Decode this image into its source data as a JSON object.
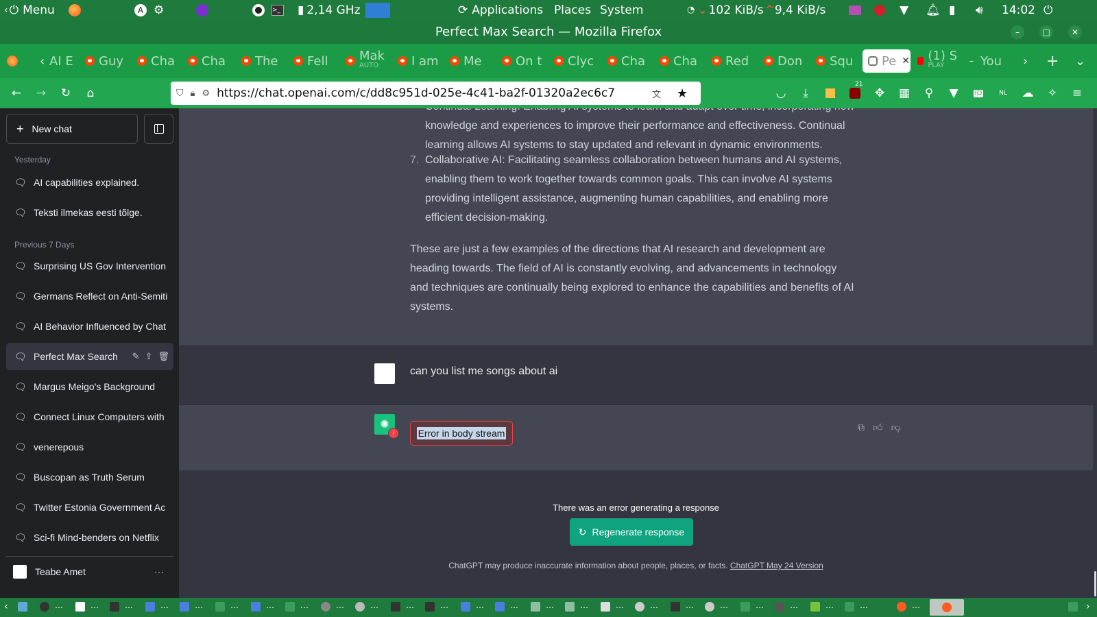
{
  "system_panel": {
    "menu_label": "Menu",
    "cpu_freq": "2,14 GHz",
    "applications": "Applications",
    "places": "Places",
    "system": "System",
    "net_down": "102 KiB/s",
    "net_up": "9,4 KiB/s",
    "clock": "14:02"
  },
  "window": {
    "title": "Perfect Max Search — Mozilla Firefox"
  },
  "tabs": [
    {
      "label": "AI E"
    },
    {
      "label": "Guy"
    },
    {
      "label": "Cha"
    },
    {
      "label": "Cha"
    },
    {
      "label": "The"
    },
    {
      "label": "Fell"
    },
    {
      "label": "Mak"
    },
    {
      "label": "I am"
    },
    {
      "label": "Me"
    },
    {
      "label": "On t"
    },
    {
      "label": "Clyc"
    },
    {
      "label": "Cha"
    },
    {
      "label": "Cha"
    },
    {
      "label": "Red"
    },
    {
      "label": "Don"
    },
    {
      "label": "Squ"
    },
    {
      "label": "Pe",
      "active": true
    },
    {
      "label": "(1) S"
    },
    {
      "label": "You"
    }
  ],
  "tab_subtitles": {
    "mak": "AUTO",
    "playing": "PLAY"
  },
  "urlbar": {
    "url": "https://chat.openai.com/c/dd8c951d-025e-4c41-ba2f-01320a2ec6c7",
    "badge_count": "21",
    "locale_badge": "NL"
  },
  "sidebar": {
    "new_chat": "New chat",
    "group_yesterday": "Yesterday",
    "group_prev7": "Previous 7 Days",
    "yesterday_items": [
      "AI capabilities explained.",
      "Teksti ilmekas eesti tõlge."
    ],
    "prev7_items": [
      "Surprising US Gov Intervention",
      "Germans Reflect on Anti-Semiti",
      "AI Behavior Influenced by Chat",
      "Perfect Max Search",
      "Margus Meigo's Background",
      "Connect Linux Computers with",
      "venerepous",
      "Buscopan as Truth Serum",
      "Twitter Estonia Government Ac",
      "Sci-fi Mind-benders on Netflix"
    ],
    "user_name": "Teabe Amet"
  },
  "conversation": {
    "item6_partial": "Continual Learning: Enabling AI systems to learn and adapt over time, incorporating new knowledge and experiences to improve their performance and effectiveness. Continual learning allows AI systems to stay updated and relevant in dynamic environments.",
    "item7_number": "7.",
    "item7": "Collaborative AI: Facilitating seamless collaboration between humans and AI systems, enabling them to work together towards common goals. This can involve AI systems providing intelligent assistance, augmenting human capabilities, and enabling more efficient decision-making.",
    "closing_paragraph": "These are just a few examples of the directions that AI research and development are heading towards. The field of AI is constantly evolving, and advancements in technology and techniques are continually being explored to enhance the capabilities and benefits of AI systems.",
    "user_message": "can you list me songs about ai",
    "error_message": "Error in body stream",
    "error_badge": "!"
  },
  "footer": {
    "error_text": "There was an error generating a response",
    "regenerate": "Regenerate response",
    "disclaimer": "ChatGPT may produce inaccurate information about people, places, or facts.",
    "version_link": "ChatGPT May 24 Version"
  },
  "colors": {
    "panel_green": "#1f7a3d",
    "sidebar_bg": "#202123",
    "assistant_bg": "#444654",
    "user_bg": "#343541",
    "accent": "#10a37f",
    "error_red": "#ef4146"
  }
}
